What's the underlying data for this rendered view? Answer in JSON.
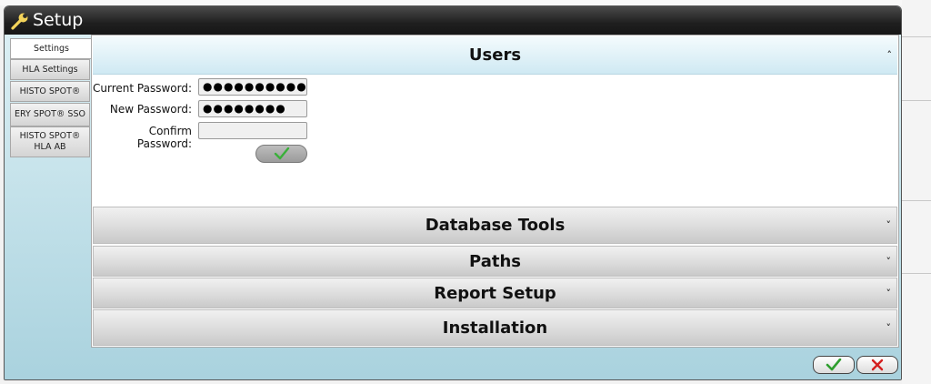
{
  "window": {
    "title": "Setup",
    "icon": "wrench-icon"
  },
  "tabs": [
    {
      "label": "Settings",
      "active": true
    },
    {
      "label": "HLA Settings",
      "active": false
    },
    {
      "label": "HISTO SPOT®",
      "active": false
    },
    {
      "label": "ERY SPOT® SSO",
      "active": false
    },
    {
      "label": "HISTO SPOT® HLA AB",
      "active": false
    }
  ],
  "sections": {
    "users": {
      "title": "Users",
      "expanded": true,
      "current_password_label": "Current Password:",
      "current_password_value": "●●●●●●●●●●●",
      "new_password_label": "New Password:",
      "new_password_value": "●●●●●●●●",
      "confirm_password_label": "Confirm Password:",
      "confirm_password_value": ""
    },
    "database_tools": {
      "title": "Database Tools",
      "expanded": false
    },
    "paths": {
      "title": "Paths",
      "expanded": false
    },
    "report_setup": {
      "title": "Report Setup",
      "expanded": false
    },
    "installation": {
      "title": "Installation",
      "expanded": false
    }
  },
  "colors": {
    "accept": "#2e9e2e",
    "cancel": "#d42020",
    "title_bar": "#1f1f1f",
    "panel_bg": "#c3dfe6"
  },
  "footer": {
    "ok_icon": "check-icon",
    "cancel_icon": "x-icon"
  }
}
